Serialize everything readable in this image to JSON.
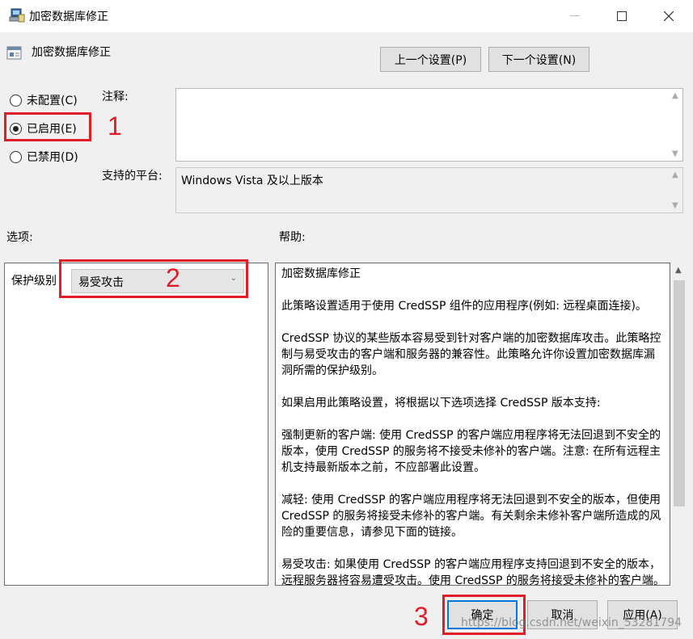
{
  "window": {
    "title": "加密数据库修正",
    "policy_name": "加密数据库修正"
  },
  "nav": {
    "prev_label": "上一个设置(P)",
    "next_label": "下一个设置(N)"
  },
  "state": {
    "options": [
      {
        "label": "未配置(C)",
        "selected": false
      },
      {
        "label": "已启用(E)",
        "selected": true
      },
      {
        "label": "已禁用(D)",
        "selected": false
      }
    ]
  },
  "labels": {
    "comment": "注释:",
    "platform": "支持的平台:",
    "options": "选项:",
    "help": "帮助:"
  },
  "platform_text": "Windows Vista 及以上版本",
  "options_panel": {
    "protection_label": "保护级别",
    "protection_value": "易受攻击"
  },
  "help_paragraphs": [
    "加密数据库修正",
    "此策略设置适用于使用 CredSSP 组件的应用程序(例如: 远程桌面连接)。",
    "CredSSP 协议的某些版本容易受到针对客户端的加密数据库攻击。此策略控制与易受攻击的客户端和服务器的兼容性。此策略允许你设置加密数据库漏洞所需的保护级别。",
    "如果启用此策略设置，将根据以下选项选择 CredSSP 版本支持:",
    "强制更新的客户端: 使用 CredSSP 的客户端应用程序将无法回退到不安全的版本，使用 CredSSP 的服务将不接受未修补的客户端。注意: 在所有远程主机支持最新版本之前，不应部署此设置。",
    "减轻: 使用 CredSSP 的客户端应用程序将无法回退到不安全的版本，但使用 CredSSP 的服务将接受未修补的客户端。有关剩余未修补客户端所造成的风险的重要信息，请参见下面的链接。",
    "易受攻击: 如果使用 CredSSP 的客户端应用程序支持回退到不安全的版本，远程服务器将容易遭受攻击。使用 CredSSP 的服务将接受未修补的客户端。"
  ],
  "buttons": {
    "ok": "确定",
    "cancel": "取消",
    "apply": "应用(A)"
  },
  "annotations": [
    "1",
    "2",
    "3"
  ],
  "watermark": "https://blog.csdn.net/weixin_53281794",
  "colors": {
    "annotation": "#e11d2a",
    "focus": "#0078d7"
  }
}
